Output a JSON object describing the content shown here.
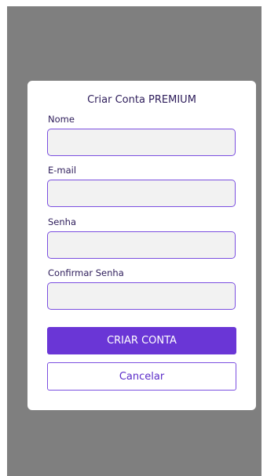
{
  "modal": {
    "title": "Criar Conta PREMIUM",
    "fields": [
      {
        "label": "Nome",
        "value": "",
        "placeholder": ""
      },
      {
        "label": "E-mail",
        "value": "",
        "placeholder": ""
      },
      {
        "label": "Senha",
        "value": "",
        "placeholder": ""
      },
      {
        "label": "Confirmar Senha",
        "value": "",
        "placeholder": ""
      }
    ],
    "submit_label": "CRIAR CONTA",
    "cancel_label": "Cancelar"
  },
  "colors": {
    "overlay": "#7f7f7f",
    "accent": "#6a36d6",
    "border": "#7b4fe0",
    "text": "#2d1c5a",
    "input_bg": "#f2f2f2"
  }
}
